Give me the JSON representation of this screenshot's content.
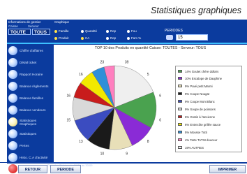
{
  "header": {
    "title": "Statistiques graphiques"
  },
  "filters": {
    "title": "Informations de gestion",
    "caisse_label": "Caisse",
    "serveur_label": "Serveur",
    "caisse_value": "TOUTE",
    "serveur_value": "TOUS"
  },
  "type": {
    "label": "Graphique",
    "options": [
      "Famille",
      "Quantité",
      "Rep",
      "Fou",
      "Produit",
      "CA",
      "Rep",
      "Fam %"
    ]
  },
  "periode": {
    "title": "PERIODES",
    "value": "15"
  },
  "sidebar": {
    "items": [
      "Chiffre d'affaires",
      "Détail ticket",
      "Rapport Horaire",
      "Balance règlements",
      "Balance familles",
      "Balance vendeurs",
      "Statistiques Graphiques",
      "Statistiques",
      "Pertes",
      "Histo. C.A d'activité"
    ]
  },
  "chart_data": {
    "type": "pie",
    "title": "TOP 10 des Produits en quantité Caisse: TOUTES - Serveur: TOUS",
    "slices": [
      {
        "label": "14% Goulet chère dollars",
        "value": 14,
        "color": "#4aa24f"
      },
      {
        "label": "10% Escalope de Dauphine",
        "value": 10,
        "color": "#8a2bd6"
      },
      {
        "label": "9% Pavé petit Marmi",
        "value": 9,
        "color": "#e8dfb8"
      },
      {
        "label": "9% Coupe Nougat",
        "value": 9,
        "color": "#1a1a1a"
      },
      {
        "label": "9% Coupe Mont Blanc",
        "value": 9,
        "color": "#3b4cc0"
      },
      {
        "label": "9% Soupe de poissons",
        "value": 9,
        "color": "#d9d9d9"
      },
      {
        "label": "6% Gratin à l'ancienne",
        "value": 6,
        "color": "#c81c1c"
      },
      {
        "label": "6% Entrecôte grillée sauce",
        "value": 6,
        "color": "#f2e900"
      },
      {
        "label": "5% Mousse Tutti",
        "value": 5,
        "color": "#2f8fd8"
      },
      {
        "label": "4% Tarte TATIN douceur",
        "value": 4,
        "color": "#ff7fbf"
      },
      {
        "label": "19% AUTRES",
        "value": 19,
        "color": "#efefef"
      }
    ],
    "data_labels": [
      "39",
      "5",
      "6",
      "6",
      "8",
      "9",
      "10",
      "13",
      "15",
      "16",
      "16",
      "23"
    ]
  },
  "footer": {
    "note": "Période affichée : du 01/09 au 30/09",
    "retour": "RETOUR",
    "periode": "PERIODE",
    "imprimer": "IMPRIMER"
  }
}
